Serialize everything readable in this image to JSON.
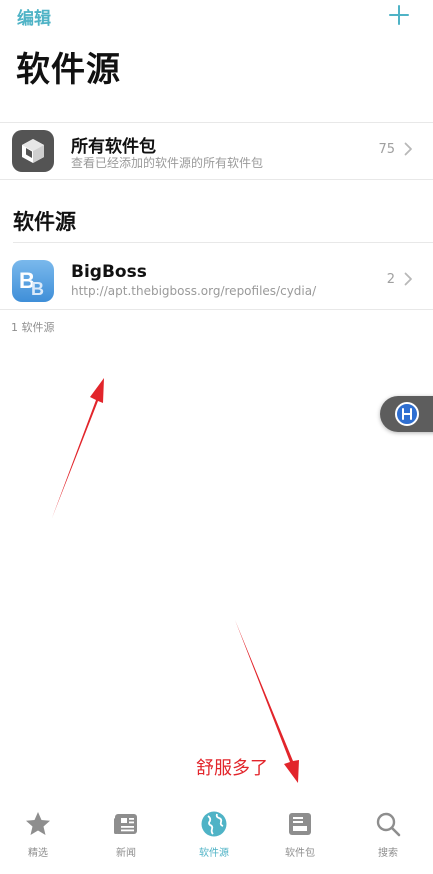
{
  "nav": {
    "edit_label": "编辑",
    "add_icon": "plus-icon"
  },
  "page_title": "软件源",
  "all_packages": {
    "title": "所有软件包",
    "subtitle": "查看已经添加的软件源的所有软件包",
    "count": "75",
    "icon": "package-box-icon"
  },
  "sources_section": {
    "header": "软件源",
    "items": [
      {
        "title": "BigBoss",
        "subtitle": "http://apt.thebigboss.org/repofiles/cydia/",
        "count": "2",
        "icon": "bigboss-logo-icon"
      }
    ],
    "footer": "1 软件源"
  },
  "annotation": {
    "text": "舒服多了",
    "color": "#e2252b"
  },
  "tabbar": {
    "tabs": [
      {
        "label": "精选",
        "icon": "star-icon",
        "active": false
      },
      {
        "label": "新闻",
        "icon": "newspaper-icon",
        "active": false
      },
      {
        "label": "软件源",
        "icon": "globe-icon",
        "active": true
      },
      {
        "label": "软件包",
        "icon": "package-icon",
        "active": false
      },
      {
        "label": "搜索",
        "icon": "search-icon",
        "active": false
      }
    ]
  },
  "colors": {
    "accent": "#4fb3c6",
    "inactive": "#8e8e8e",
    "annotation": "#e2252b"
  }
}
